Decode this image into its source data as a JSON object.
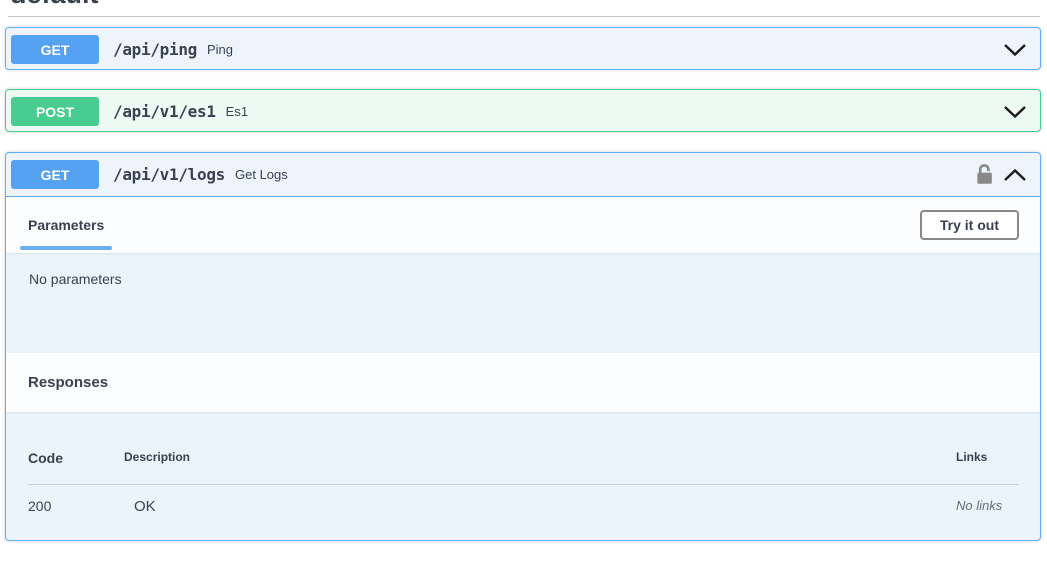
{
  "page": {
    "tag_heading": "default"
  },
  "colors": {
    "get_accent": "#55a1f2",
    "get_border": "#61affe",
    "get_bg": "#edf4fc",
    "post_accent": "#49cc90",
    "post_bg": "#edfaf3",
    "text": "#3b4151",
    "tab_underline": "#6aaef3",
    "button_border": "#888888"
  },
  "operations": [
    {
      "method": "GET",
      "path": "/api/ping",
      "summary": "Ping",
      "state": "collapsed"
    },
    {
      "method": "POST",
      "path": "/api/v1/es1",
      "summary": "Es1",
      "state": "collapsed"
    },
    {
      "method": "GET",
      "path": "/api/v1/logs",
      "summary": "Get Logs",
      "state": "expanded"
    }
  ],
  "expanded_operation": {
    "parameters_section": {
      "title": "Parameters",
      "try_it_out_label": "Try it out",
      "empty_message": "No parameters"
    },
    "responses_section": {
      "title": "Responses",
      "table": {
        "headers": {
          "code": "Code",
          "description": "Description",
          "links": "Links"
        },
        "rows": [
          {
            "code": "200",
            "description": "OK",
            "links": "No links"
          }
        ]
      }
    }
  }
}
